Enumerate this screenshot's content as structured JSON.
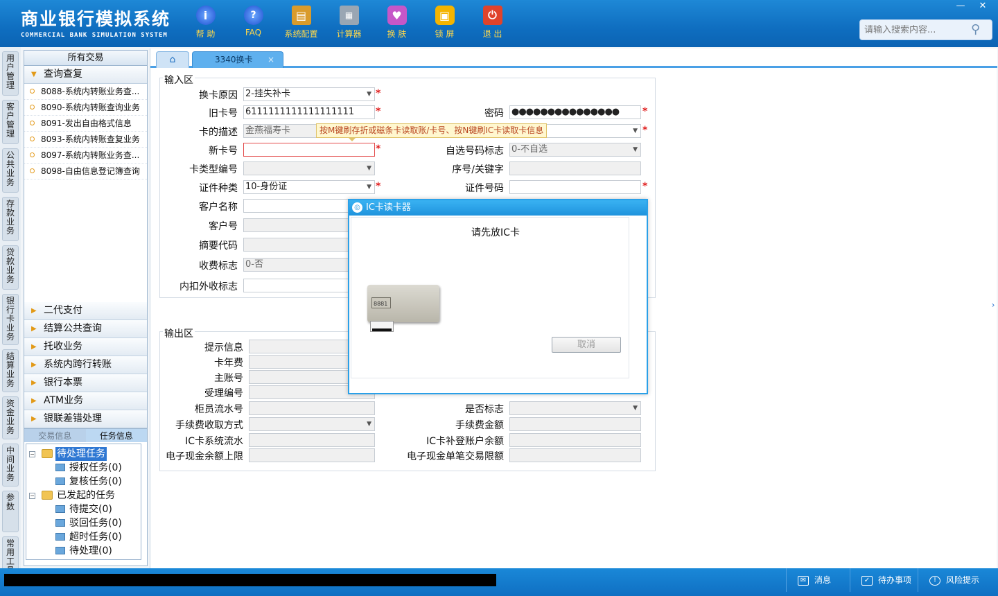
{
  "app": {
    "title_cn": "商业银行模拟系统",
    "title_en": "COMMERCIAL BANK SIMULATION SYSTEM"
  },
  "toolbar": [
    {
      "label": "帮 助",
      "icon": "help-icon"
    },
    {
      "label": "FAQ",
      "icon": "faq-icon"
    },
    {
      "label": "系统配置",
      "icon": "config-icon"
    },
    {
      "label": "计算器",
      "icon": "calculator-icon"
    },
    {
      "label": "换 肤",
      "icon": "skin-icon"
    },
    {
      "label": "锁 屏",
      "icon": "lock-icon"
    },
    {
      "label": "退 出",
      "icon": "exit-icon"
    }
  ],
  "search": {
    "placeholder": "请输入搜索内容..."
  },
  "vertical_tabs": [
    "用户管理",
    "客户管理",
    "公共业务",
    "存款业务",
    "贷款业务",
    "银行卡业务",
    "结算业务",
    "资金业务",
    "中间业务",
    "参数",
    "常用工具"
  ],
  "menu": {
    "header": "所有交易",
    "open_group": "查询查复",
    "open_items": [
      "8088-系统内转账业务查...",
      "8090-系统内转账查询业务",
      "8091-发出自由格式信息",
      "8093-系统内转账查复业务",
      "8097-系统内转账业务查...",
      "8098-自由信息登记簿查询"
    ],
    "groups": [
      "二代支付",
      "结算公共查询",
      "托收业务",
      "系统内跨行转账",
      "银行本票",
      "ATM业务",
      "银联差错处理"
    ]
  },
  "info_tabs": {
    "left": "交易信息",
    "right": "任务信息"
  },
  "tree": {
    "pending": "待处理任务",
    "auth": "授权任务(0)",
    "review": "复核任务(0)",
    "initiated": "已发起的任务",
    "to_submit": "待提交(0)",
    "rejected": "驳回任务(0)",
    "timeout": "超时任务(0)",
    "to_process": "待处理(0)"
  },
  "tabs": {
    "active": "3340换卡",
    "close": "×"
  },
  "input_section": {
    "title": "输入区",
    "reason_label": "换卡原因",
    "reason_value": "2-挂失补卡",
    "old_card_label": "旧卡号",
    "old_card_value": "6111111111111111111",
    "password_label": "密码",
    "password_value": "●●●●●●●●●●●●●●●",
    "desc_label": "卡的描述",
    "desc_value": "金燕福寿卡",
    "new_card_label": "新卡号",
    "self_select_label": "自选号码标志",
    "self_select_value": "0-不自选",
    "card_type_label": "卡类型编号",
    "seq_label": "序号/关键字",
    "id_type_label": "证件种类",
    "id_type_value": "10-身份证",
    "id_no_label": "证件号码",
    "cust_name_label": "客户名称",
    "cust_no_label": "客户号",
    "summary_label": "摘要代码",
    "fee_label": "收费标志",
    "fee_value": "0-否",
    "inner_outer_label": "内扣外收标志"
  },
  "tooltip": "按M键刷存折或磁条卡读取账/卡号、按N键刷IC卡读取卡信息",
  "output_section": {
    "title": "输出区",
    "hint_label": "提示信息",
    "annual_fee_label": "卡年费",
    "main_acct_label": "主账号",
    "accept_no_label": "受理编号",
    "teller_seq_label": "柜员流水号",
    "yes_no_label": "是否标志",
    "fee_method_label": "手续费收取方式",
    "fee_amount_label": "手续费金额",
    "ic_seq_label": "IC卡系统流水",
    "ic_balance_label": "IC卡补登账户余额",
    "ecash_limit_label": "电子现金余额上限",
    "ecash_single_label": "电子现金单笔交易限额"
  },
  "dialog": {
    "title": "IC卡读卡器",
    "message": "请先放IC卡",
    "cancel": "取消",
    "reader_label": "8881"
  },
  "statusbar": {
    "message": "消息",
    "todo": "待办事项",
    "risk": "风险提示"
  }
}
